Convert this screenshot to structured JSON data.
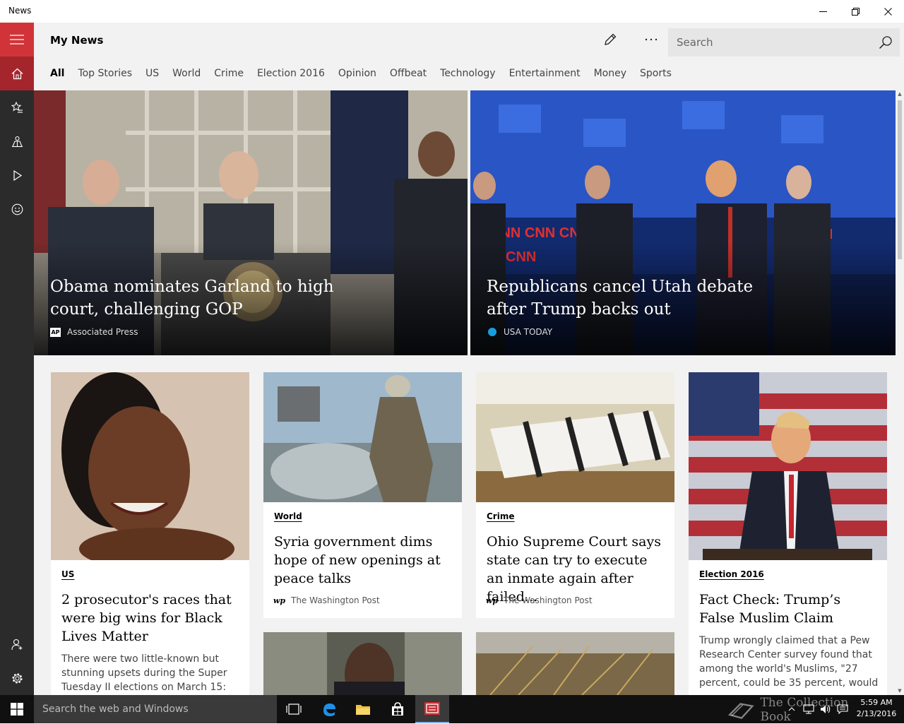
{
  "window": {
    "title": "News"
  },
  "header": {
    "title": "My News"
  },
  "search": {
    "placeholder": "Search"
  },
  "tabs": [
    {
      "label": "All"
    },
    {
      "label": "Top Stories"
    },
    {
      "label": "US"
    },
    {
      "label": "World"
    },
    {
      "label": "Crime"
    },
    {
      "label": "Election 2016"
    },
    {
      "label": "Opinion"
    },
    {
      "label": "Offbeat"
    },
    {
      "label": "Technology"
    },
    {
      "label": "Entertainment"
    },
    {
      "label": "Money"
    },
    {
      "label": "Sports"
    }
  ],
  "hero": [
    {
      "title": "Obama nominates Garland to high court, challenging GOP",
      "source": "Associated Press",
      "source_logo": "AP"
    },
    {
      "title": "Republicans cancel Utah debate after Trump backs out",
      "source": "USA TODAY"
    }
  ],
  "cards": [
    {
      "category": "US",
      "title": "2 prosecutor's races that were big wins for Black Lives Matter",
      "summary": "There were two little-known but stunning upsets during the Super Tuesday II elections on March 15:"
    },
    {
      "category": "World",
      "title": "Syria government dims hope of new openings at peace talks",
      "source": "The Washington Post",
      "source_logo": "wp"
    },
    {
      "category": "Crime",
      "title": "Ohio Supreme Court says state can try to execute an inmate again after failed...",
      "source": "The Washington Post",
      "source_logo": "wp"
    },
    {
      "category": "Election 2016",
      "title": "Fact Check: Trump’s False Muslim Claim",
      "summary": "Trump wrongly claimed that a Pew Research Center survey found that among the world's Muslims, \"27 percent, could be 35 percent, would"
    }
  ],
  "taskbar": {
    "search_placeholder": "Search the web and Windows",
    "time": "5:59 AM",
    "date": "2/13/2016",
    "watermark": "The Collection Book"
  },
  "colors": {
    "accent": "#d13438",
    "accent_dark": "#a4262c",
    "sidebar": "#2b2b2b",
    "background": "#f2f2f2"
  }
}
